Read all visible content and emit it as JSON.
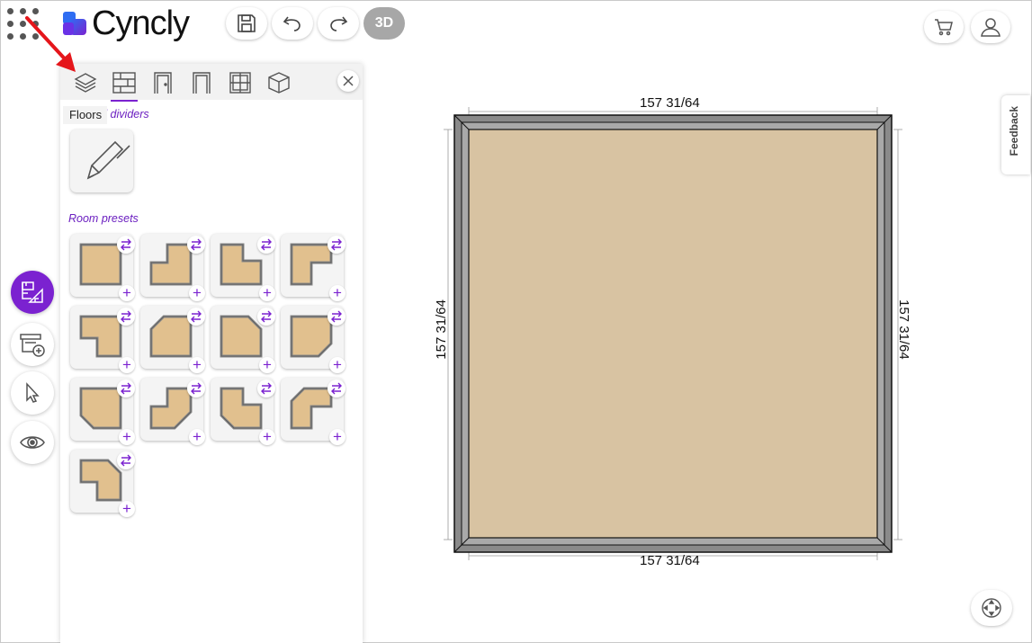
{
  "app": {
    "brand_name": "Cyncly",
    "view_mode_label": "3D",
    "accent_color": "#7b22d0"
  },
  "toolbar": {
    "icons": [
      "apps-grid-icon",
      "save-icon",
      "undo-icon",
      "redo-icon",
      "cart-icon",
      "user-icon"
    ]
  },
  "panel": {
    "tabs": [
      {
        "name": "floors",
        "icon": "layers-icon"
      },
      {
        "name": "walls",
        "icon": "brick-wall-icon",
        "active": true
      },
      {
        "name": "doors",
        "icon": "door-icon"
      },
      {
        "name": "openings",
        "icon": "opening-icon"
      },
      {
        "name": "windows",
        "icon": "window-icon"
      },
      {
        "name": "objects",
        "icon": "cube-icon"
      }
    ],
    "tooltip": "Floors",
    "walls_section_label": "Walls and dividers",
    "walls_section_label_visible": "alls and dividers",
    "room_presets_label": "Room presets",
    "preset_count": 13
  },
  "left_rail": {
    "items": [
      {
        "name": "floorplan",
        "icon": "floorplan-icon",
        "active": true
      },
      {
        "name": "add-furniture",
        "icon": "add-cabinet-icon"
      },
      {
        "name": "select",
        "icon": "cursor-icon"
      },
      {
        "name": "view",
        "icon": "eye-icon"
      }
    ]
  },
  "canvas": {
    "dimension_top": "157 31/64",
    "dimension_bottom": "157 31/64",
    "dimension_left": "157 31/64",
    "dimension_right": "157 31/64",
    "floor_color": "#d8c3a2",
    "wall_color": "#8a8a8a"
  },
  "feedback_label": "Feedback"
}
